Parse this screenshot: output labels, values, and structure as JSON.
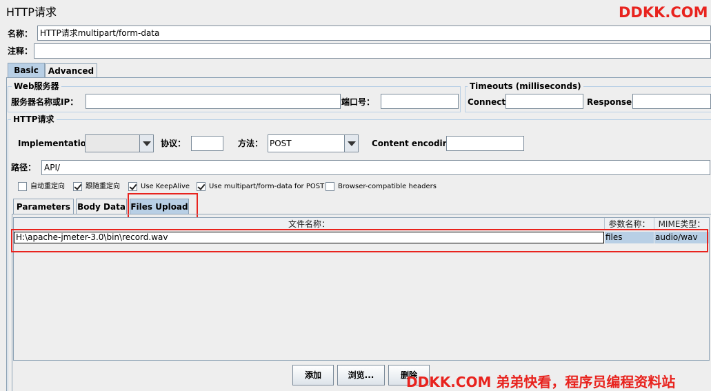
{
  "title": "HTTP请求",
  "watermark_top": "DDKK.COM",
  "watermark_bottom": "DDKK.COM 弟弟快看，程序员编程资料站",
  "name_label": "名称：",
  "name_value": "HTTP请求multipart/form-data",
  "comment_label": "注释：",
  "comment_value": "",
  "outer_tabs": [
    "Basic",
    "Advanced"
  ],
  "web_server": {
    "legend": "Web服务器",
    "server_label": "服务器名称或IP：",
    "server_value": "",
    "port_label": "端口号：",
    "port_value": ""
  },
  "timeouts": {
    "legend": "Timeouts (milliseconds)",
    "connect_label": "Connect:",
    "connect_value": "",
    "response_label": "Response:",
    "response_value": ""
  },
  "http_request": {
    "legend": "HTTP请求",
    "implementation_label": "Implementation:",
    "implementation_value": "",
    "protocol_label": "协议：",
    "protocol_value": "",
    "method_label": "方法：",
    "method_value": "POST",
    "encoding_label": "Content encoding:",
    "encoding_value": "",
    "path_label": "路径：",
    "path_value": "API/"
  },
  "checkboxes": [
    {
      "label": "自动重定向",
      "checked": false
    },
    {
      "label": "跟随重定向",
      "checked": true
    },
    {
      "label": "Use KeepAlive",
      "checked": true
    },
    {
      "label": "Use multipart/form-data for POST",
      "checked": true
    },
    {
      "label": "Browser-compatible headers",
      "checked": false
    }
  ],
  "inner_tabs": [
    "Parameters",
    "Body Data",
    "Files Upload"
  ],
  "files_table": {
    "headers": [
      "文件名称：",
      "参数名称：",
      "MIME类型："
    ],
    "rows": [
      {
        "file": "H:\\apache-jmeter-3.0\\bin\\record.wav",
        "param": "files",
        "mime": "audio/wav"
      }
    ]
  },
  "buttons": {
    "add": "添加",
    "browse": "浏览...",
    "delete": "删除"
  },
  "colors": {
    "active_tab": "#b8cfe5",
    "highlight_box": "#e8231e",
    "selected_row": "#b8cfe5"
  }
}
